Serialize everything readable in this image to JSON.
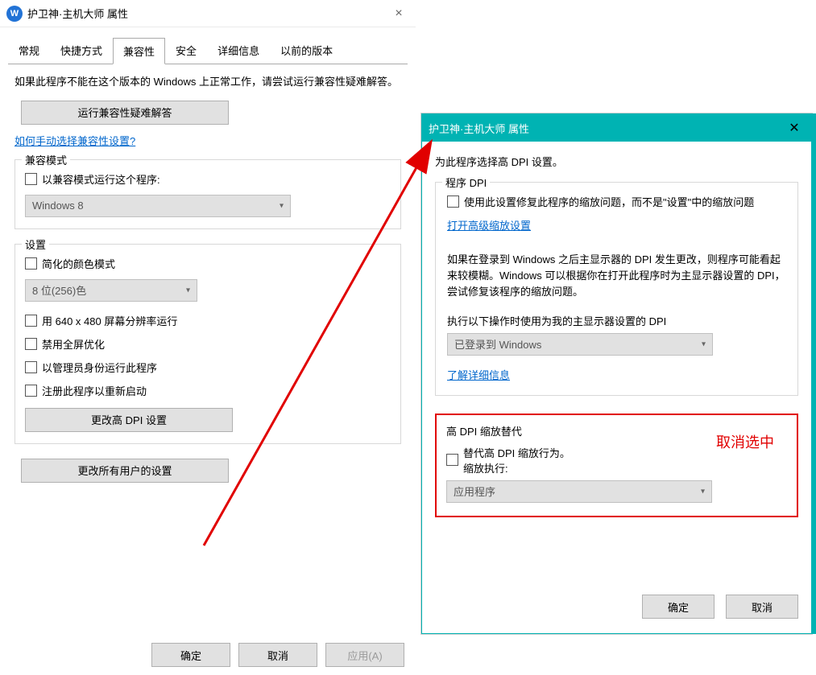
{
  "left": {
    "title": "护卫神·主机大师 属性",
    "tabs": [
      "常规",
      "快捷方式",
      "兼容性",
      "安全",
      "详细信息",
      "以前的版本"
    ],
    "help": "如果此程序不能在这个版本的 Windows 上正常工作，请尝试运行兼容性疑难解答。",
    "run_troubleshooter": "运行兼容性疑难解答",
    "manual_link": "如何手动选择兼容性设置?",
    "compat_mode_group": "兼容模式",
    "compat_mode_cb": "以兼容模式运行这个程序:",
    "compat_mode_value": "Windows 8",
    "settings_group": "设置",
    "reduced_color_cb": "简化的颜色模式",
    "color_value": "8 位(256)色",
    "res_cb": "用 640 x 480 屏幕分辨率运行",
    "disable_fs_cb": "禁用全屏优化",
    "admin_cb": "以管理员身份运行此程序",
    "reg_restart_cb": "注册此程序以重新启动",
    "change_dpi": "更改高 DPI 设置",
    "change_all_users": "更改所有用户的设置",
    "ok": "确定",
    "cancel": "取消",
    "apply": "应用(A)"
  },
  "right": {
    "title": "护卫神·主机大师 属性",
    "intro": "为此程序选择高 DPI 设置。",
    "program_dpi_group": "程序 DPI",
    "fix_cb": "使用此设置修复此程序的缩放问题，而不是\"设置\"中的缩放问题",
    "adv_link": "打开高级缩放设置",
    "desc": "如果在登录到 Windows 之后主显示器的 DPI 发生更改，则程序可能看起来较模糊。Windows 可以根据你在打开此程序时为主显示器设置的 DPI，尝试修复该程序的缩放问题。",
    "when_label": "执行以下操作时使用为我的主显示器设置的 DPI",
    "when_value": "已登录到 Windows",
    "learn_link": "了解详细信息",
    "override_group": "高 DPI 缩放替代",
    "override_cb": "替代高 DPI 缩放行为。",
    "override_sub": "缩放执行:",
    "override_value": "应用程序",
    "ok": "确定",
    "cancel": "取消"
  },
  "annotation": {
    "note": "取消选中"
  }
}
